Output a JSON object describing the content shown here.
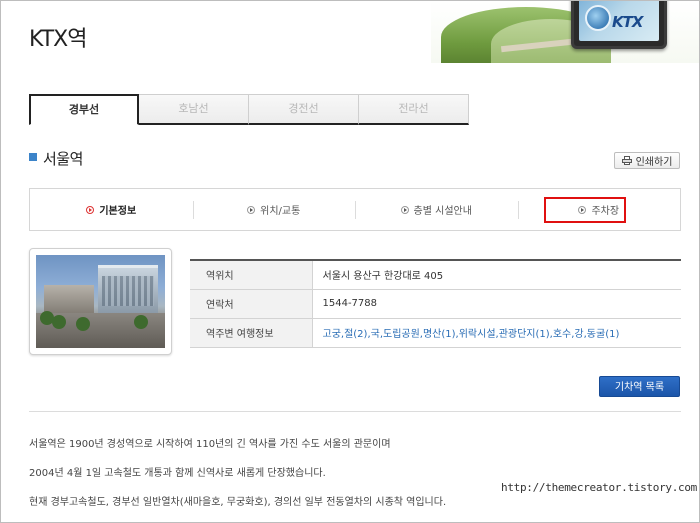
{
  "page": {
    "title": "KTX역"
  },
  "header": {
    "logo_text": "KTX"
  },
  "tabs": [
    {
      "label": "경부선",
      "active": true
    },
    {
      "label": "호남선",
      "active": false
    },
    {
      "label": "경전선",
      "active": false
    },
    {
      "label": "전라선",
      "active": false
    }
  ],
  "station": {
    "name": "서울역",
    "print_label": "인쇄하기"
  },
  "subnav": [
    {
      "label": "기본정보",
      "active": true
    },
    {
      "label": "위치/교통",
      "active": false
    },
    {
      "label": "층별 시설안내",
      "active": false
    },
    {
      "label": "주차장",
      "active": false,
      "highlighted": true
    }
  ],
  "info": {
    "rows": [
      {
        "header": "역위치",
        "value": "서울시 용산구 한강대로 405"
      },
      {
        "header": "연락처",
        "value": "1544-7788"
      },
      {
        "header": "역주변 여행정보",
        "value": "고궁,절(2),국,도립공원,명산(1),위락시설,관광단지(1),호수,강,동굴(1)"
      }
    ]
  },
  "buttons": {
    "station_list": "기차역 목록"
  },
  "description": [
    "서울역은 1900년 경성역으로 시작하여 110년의 긴 역사를 가진 수도 서울의 관문이며",
    "2004년 4월 1일 고속철도 개통과 함께 신역사로 새롭게 단장했습니다.",
    "현재 경부고속철도, 경부선 일반열차(새마을호, 무궁화호), 경의선 일부 전동열차의 시종착 역입니다."
  ],
  "watermark": "http://themecreator.tistory.com",
  "colors": {
    "accent_blue": "#3c84c9",
    "highlight_red": "#e01010",
    "button_blue": "#1b55a9",
    "link_blue": "#2a6db5"
  }
}
